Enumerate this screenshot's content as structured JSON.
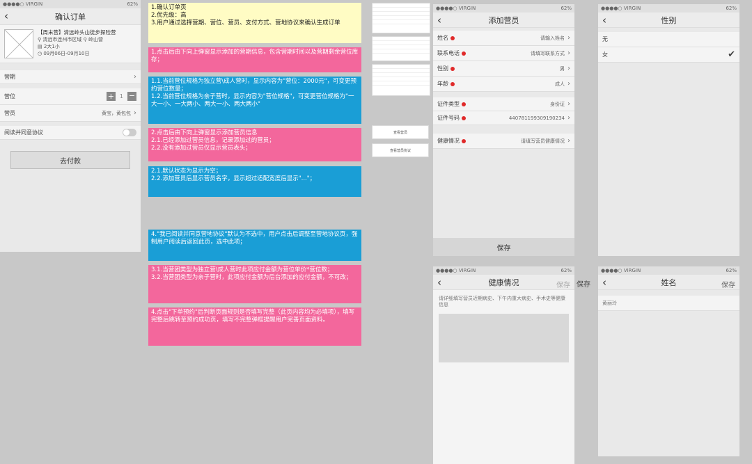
{
  "status": {
    "carrier": "●●●●○ VIRGIN",
    "battery": "62%"
  },
  "confirm": {
    "title": "确认订单",
    "product_name": "【周末营】清远岭头山徒步探险营",
    "product_loc": "清远市连州市区域",
    "product_tag": "岭山营",
    "product_size": "2大1小",
    "product_date": "09月06日-09月10日",
    "camp_label": "营期",
    "position_label": "营位",
    "qty": "1",
    "member_label": "营员",
    "member_value": "黄宝，黄包包",
    "agree_label": "阅读并同意协议",
    "pay_button": "去付款"
  },
  "notes": {
    "n1": "1.确认订单页\n2.优先级：高\n3.用户通过选择营期、营位、营员、支付方式、营地协议来确认生成订单",
    "n2": "1.点击后由下向上弹窗显示添加的营期信息，包含营期时间以及营期剩余营位库存；",
    "n3": "1.1.当前营位规格为独立营\\成人营时，显示内容为\"营位：2000元\"，可变更预约营位数量；\n1.2.当前营位规格为亲子营时，显示内容为\"营位规格\"，可变更营位规格为\"一大一小、一大两小、两大一小、两大两小\"",
    "n4": "2.点击后由下向上弹窗显示添加营员信息\n2.1.已经添加过营员信息，记录添加过的营员；\n2.2.没有添加过营员仅显示营员表头；",
    "n5": "2.1.默认状态为显示为空；\n2.2.添加营员后显示营员名字，显示超过适配宽度后显示\"...\"；",
    "n6": "4.\"我已阅读并同意营地协议\"默认为不选中，用户点击后调整至营地协议页，强制用户阅读后返回此页，选中此项；",
    "n7": "3.1.当营团类型为独立营\\成人营时此项应付金额为营位单价*营位数；\n3.2.当营团类型为亲子营时，此项应付金额为后台添加的应付金额，不可改；",
    "n8": "4.点击\"下单预约\"后判断页面规则是否填写完整（此页内容均为必填项），填写完整后跳转至预约成功页，填写不完整弹框提醒用户完善页面资料。"
  },
  "mini": {
    "btn1": "查看营员",
    "btn2": "查看营员协议"
  },
  "add_member": {
    "title": "添加营员",
    "rows": [
      {
        "label": "姓名",
        "value": "请输入姓名"
      },
      {
        "label": "联系电话",
        "value": "请填写联系方式"
      },
      {
        "label": "性别",
        "value": "男"
      },
      {
        "label": "年龄",
        "value": "成人"
      },
      {
        "label": "证件类型",
        "value": "身份证"
      },
      {
        "label": "证件号码",
        "value": "440781199309190234"
      },
      {
        "label": "健康情况",
        "value": "请填写营员健康情况"
      }
    ],
    "save": "保存"
  },
  "gender": {
    "title": "性别",
    "options": [
      "无",
      "女"
    ]
  },
  "health": {
    "title": "健康情况",
    "save": "保存",
    "outer_save": "保存",
    "placeholder": "请详细填写营员近期病史、下午内重大病史、手术史等健康信息"
  },
  "name_page": {
    "title": "姓名",
    "save": "保存",
    "value": "黄丽玲"
  }
}
